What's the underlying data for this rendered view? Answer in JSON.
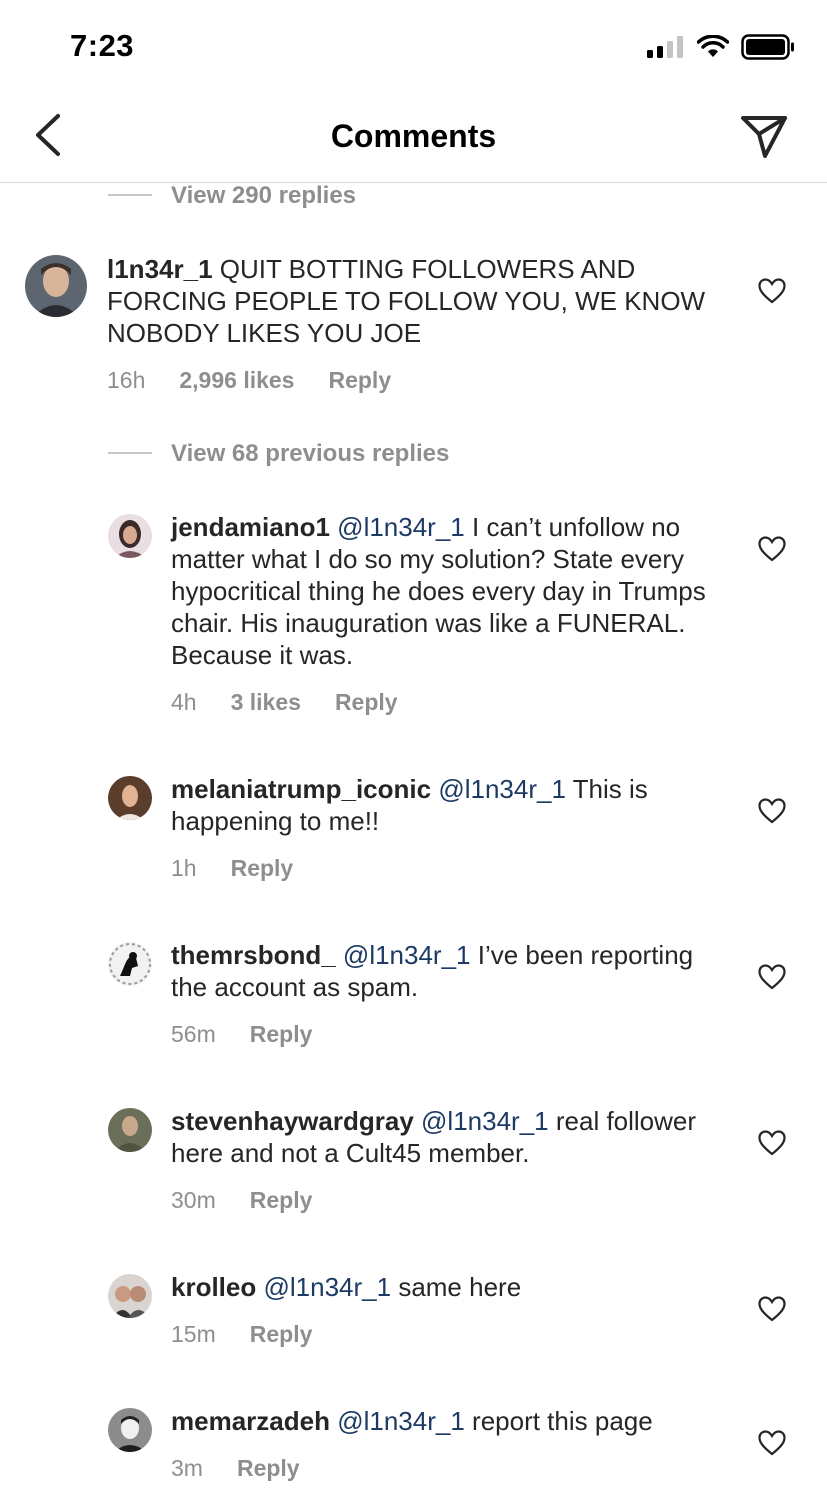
{
  "status": {
    "time": "7:23"
  },
  "header": {
    "title": "Comments"
  },
  "colors": {
    "mention": "#1d3a64",
    "meta": "#8e8e8e",
    "text": "#262626",
    "divider": "#dbdbdb"
  },
  "thread": {
    "top_view_replies": "View 290 replies",
    "comment": {
      "username": "l1n34r_1",
      "text": "QUIT BOTTING FOLLOWERS AND FORCING PEOPLE TO FOLLOW YOU, WE KNOW NOBODY LIKES YOU JOE",
      "time": "16h",
      "likes": "2,996 likes",
      "reply": "Reply"
    },
    "view_previous": "View 68 previous replies",
    "replies": [
      {
        "username": "jendamiano1",
        "mention": "@l1n34r_1",
        "text": "I can’t unfollow no matter what I do so my solution? State every hypocritical thing he does every day in Trumps chair. His inauguration was like a FUNERAL. Because it was.",
        "time": "4h",
        "likes": "3 likes",
        "reply": "Reply"
      },
      {
        "username": "melaniatrump_iconic",
        "mention": "@l1n34r_1",
        "text": "This is happening to me!!",
        "time": "1h",
        "reply": "Reply"
      },
      {
        "username": "themrsbond_",
        "mention": "@l1n34r_1",
        "text": "I’ve been reporting the account as spam.",
        "time": "56m",
        "reply": "Reply"
      },
      {
        "username": "stevenhaywardgray",
        "mention": "@l1n34r_1",
        "text": " real follower here and not a Cult45 member.",
        "time": "30m",
        "reply": "Reply"
      },
      {
        "username": "krolleo",
        "mention": "@l1n34r_1",
        "text": "same here",
        "time": "15m",
        "reply": "Reply"
      },
      {
        "username": "memarzadeh",
        "mention": "@l1n34r_1",
        "text": "report this page",
        "time": "3m",
        "reply": "Reply"
      }
    ]
  },
  "icons": {
    "back": "chevron-left-icon",
    "send": "paper-plane-icon",
    "like": "heart-outline-icon"
  }
}
